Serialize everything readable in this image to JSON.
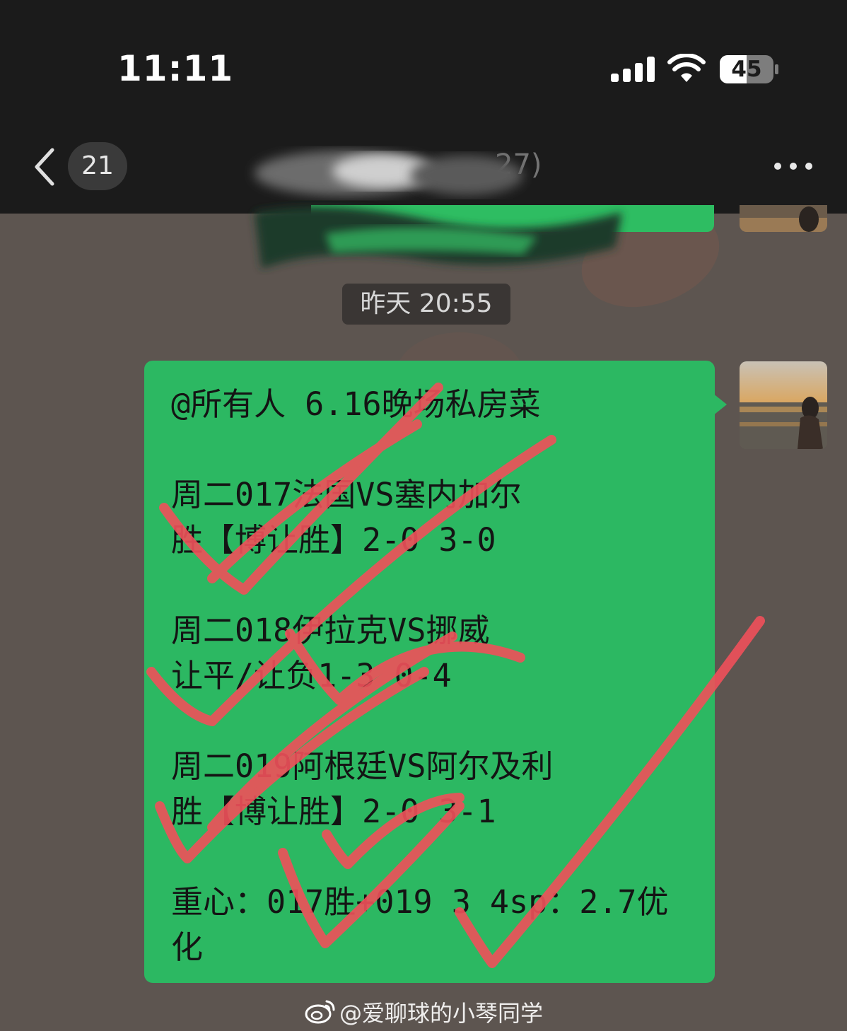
{
  "status_bar": {
    "time": "11:11",
    "battery_level": "45",
    "signal_icon": "cellular-signal-icon",
    "wifi_icon": "wifi-icon",
    "battery_icon": "battery-icon"
  },
  "nav_bar": {
    "back_icon": "chevron-left-icon",
    "unread_count": "21",
    "title_partial": "27)",
    "more_icon": "more-dots-icon"
  },
  "chat": {
    "timestamp": "昨天 20:55",
    "message": "@所有人 6.16晚场私房菜\n\n周二017法国VS塞内加尔\n胜【博让胜】2-0 3-0\n\n周二018伊拉克VS挪威\n让平/让负1-3 0-4\n\n周二019阿根廷VS阿尔及利\n胜【博让胜】2-0 3-1\n\n重心：017胜+019 3 4sp：2.7优\n化"
  },
  "watermark": {
    "icon": "weibo-icon",
    "text": "@爱聊球的小琴同学"
  },
  "colors": {
    "bar_bg": "#1b1b1b",
    "chat_bg": "#5d5550",
    "bubble_green": "#2cb862",
    "check_red": "#f0505a"
  }
}
